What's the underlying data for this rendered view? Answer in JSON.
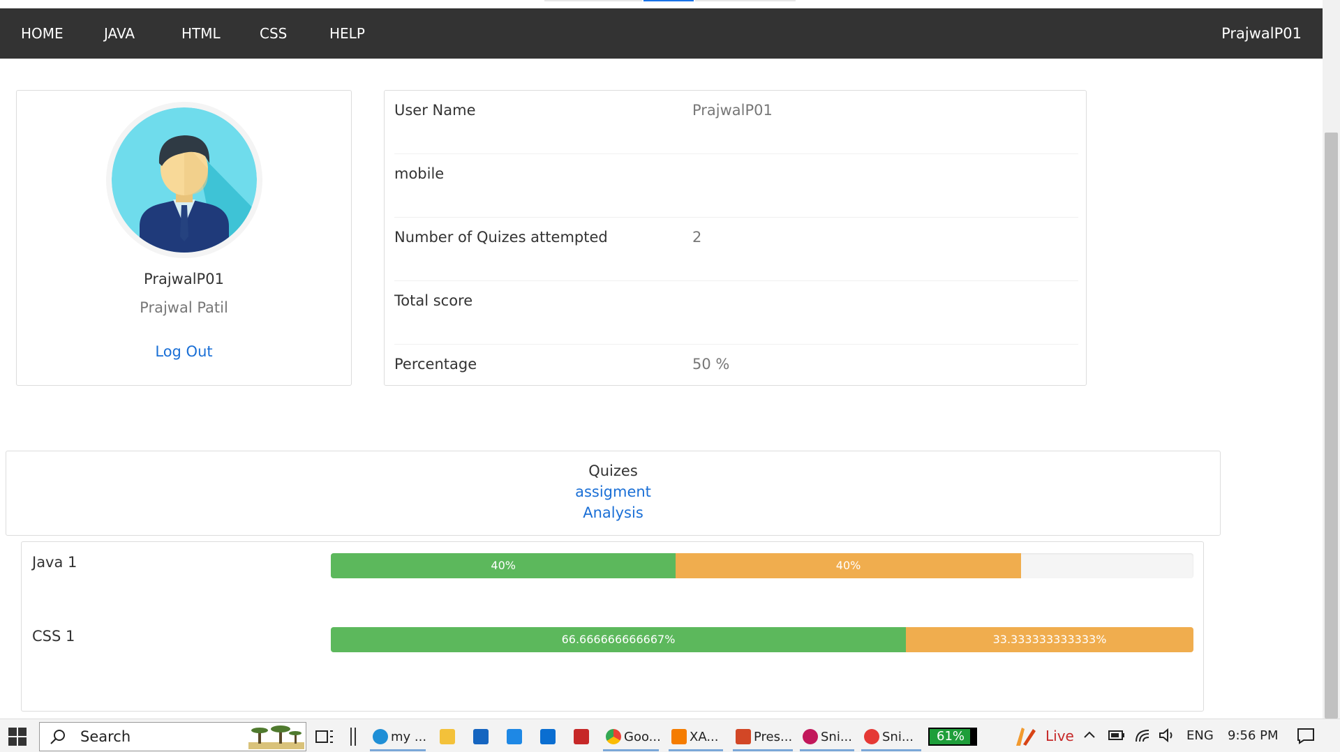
{
  "nav": {
    "items": [
      "HOME",
      "JAVA",
      "HTML",
      "CSS",
      "HELP"
    ],
    "user": "PrajwalP01"
  },
  "profile": {
    "username": "PrajwalP01",
    "full_name": "Prajwal Patil",
    "logout": "Log Out"
  },
  "details": [
    {
      "label": "User Name",
      "value": "PrajwalP01"
    },
    {
      "label": "mobile",
      "value": ""
    },
    {
      "label": "Number of Quizes attempted",
      "value": "2"
    },
    {
      "label": "Total score",
      "value": ""
    },
    {
      "label": "Percentage",
      "value": "50 %"
    }
  ],
  "quizes": {
    "title": "Quizes",
    "link_assignment": "assigment",
    "link_analysis": "Analysis"
  },
  "results": [
    {
      "name": "Java 1",
      "green_pct": 40,
      "green_label": "40%",
      "orange_pct": 40,
      "orange_label": "40%"
    },
    {
      "name": "CSS 1",
      "green_pct": 66.666666666667,
      "green_label": "66.666666666667%",
      "orange_pct": 33.333333333333,
      "orange_label": "33.333333333333%"
    }
  ],
  "colors": {
    "nav_bg": "#333333",
    "link": "#1a6fd6",
    "bar_green": "#5cb85c",
    "bar_orange": "#f0ad4e"
  },
  "taskbar": {
    "search_label": "Search",
    "apps": [
      {
        "name": "edge",
        "label": "my ...",
        "icon": "edge-icon"
      },
      {
        "name": "file-explorer",
        "label": "",
        "icon": "folder-icon"
      },
      {
        "name": "mail",
        "label": "",
        "icon": "mail-icon"
      },
      {
        "name": "l-app",
        "label": "",
        "icon": "l-app-icon"
      },
      {
        "name": "outlook",
        "label": "",
        "icon": "outlook-icon"
      },
      {
        "name": "mcafee",
        "label": "",
        "icon": "shield-icon"
      },
      {
        "name": "chrome",
        "label": "Goo...",
        "icon": "chrome-icon"
      },
      {
        "name": "xampp",
        "label": "XA...",
        "icon": "xampp-icon"
      },
      {
        "name": "powerpoint",
        "label": "Pres...",
        "icon": "powerpoint-icon"
      },
      {
        "name": "snip1",
        "label": "Sni...",
        "icon": "scissors-icon"
      },
      {
        "name": "snip2",
        "label": "Sni...",
        "icon": "scissors-icon"
      }
    ],
    "battery_label": "61%",
    "live_label": "Live",
    "language": "ENG",
    "time": "9:56 PM"
  }
}
